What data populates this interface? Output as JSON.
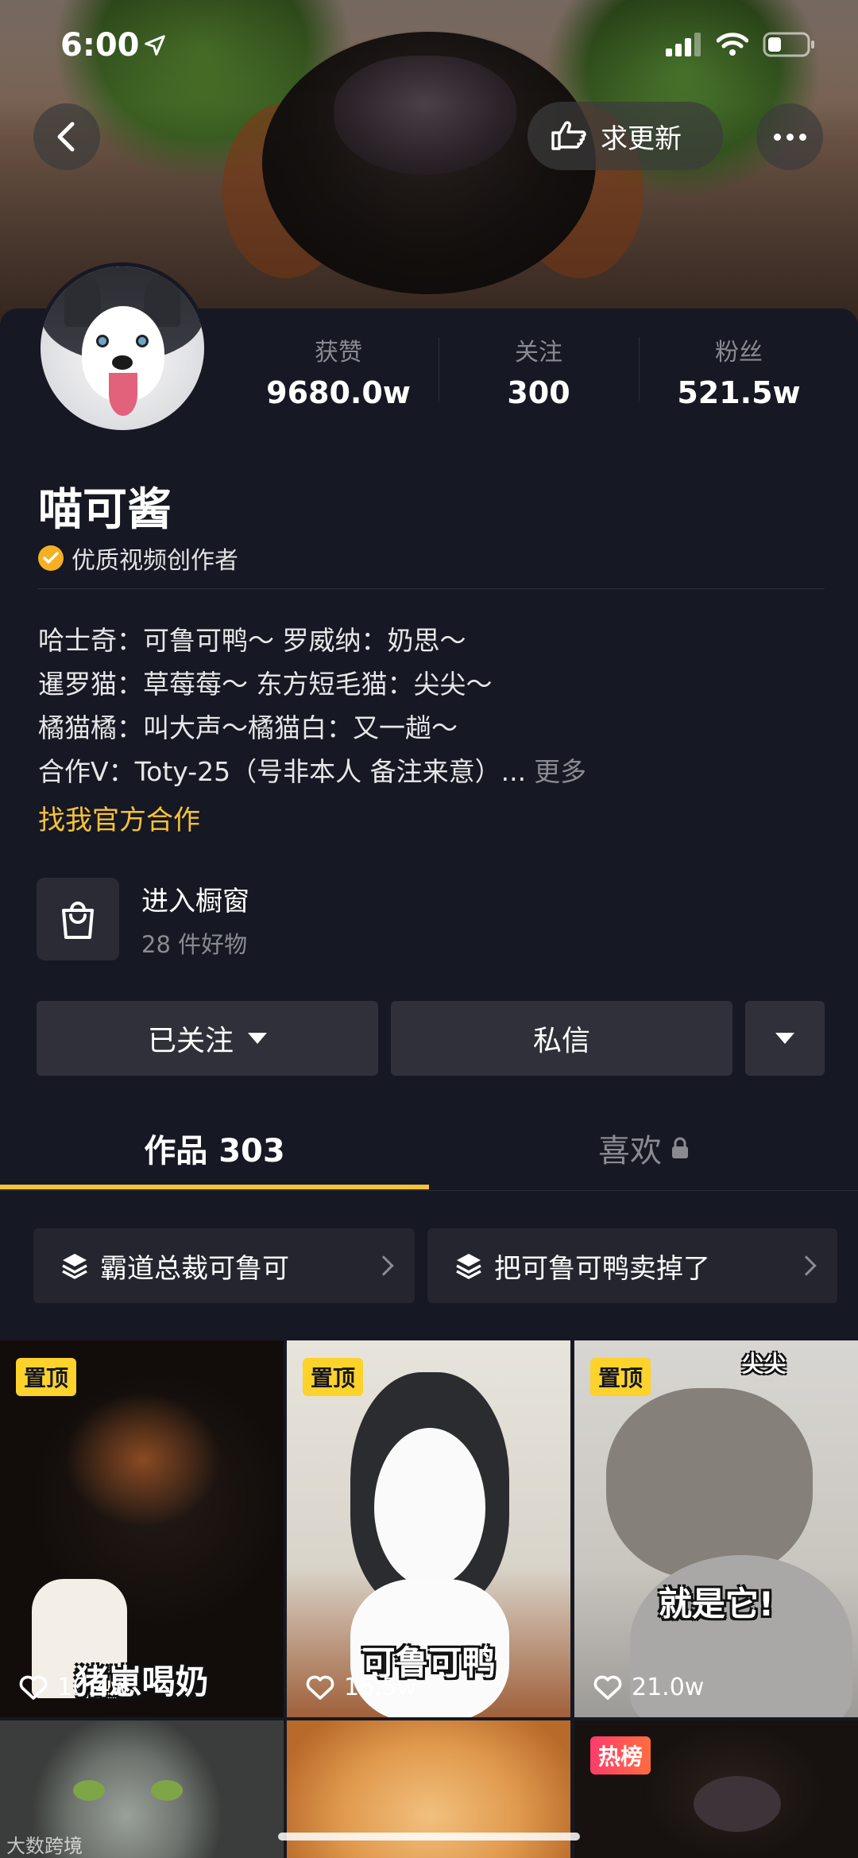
{
  "status_bar": {
    "time": "6:00"
  },
  "header": {
    "update_label": "求更新"
  },
  "profile": {
    "name": "喵可酱",
    "verified_text": "优质视频创作者",
    "stats": [
      {
        "label": "获赞",
        "value": "9680.0w"
      },
      {
        "label": "关注",
        "value": "300"
      },
      {
        "label": "粉丝",
        "value": "521.5w"
      }
    ],
    "bio_lines": [
      "哈士奇：可鲁可鸭～ 罗威纳：奶思～",
      "暹罗猫：草莓莓～ 东方短毛猫：尖尖～",
      "橘猫橘：叫大声～橘猫白：又一趟～",
      "合作V：Toty-25（号非本人 备注来意）..."
    ],
    "bio_more": "更多",
    "cooperation_link": "找我官方合作"
  },
  "shop": {
    "title": "进入橱窗",
    "subtitle": "28 件好物"
  },
  "actions": {
    "follow_label": "已关注",
    "message_label": "私信"
  },
  "tabs": {
    "works_label": "作品 303",
    "likes_label": "喜欢"
  },
  "collections": [
    {
      "label": "霸道总裁可鲁可"
    },
    {
      "label": "把可鲁可鸭卖掉了"
    }
  ],
  "videos": [
    {
      "badge": "置顶",
      "likes": "10.4w",
      "caption": "猪崽喝奶"
    },
    {
      "badge": "置顶",
      "likes": "16.5w",
      "caption": "可鲁可鸭"
    },
    {
      "badge": "置顶",
      "likes": "21.0w",
      "caption": "就是它!",
      "top_caption": "尖尖"
    },
    {
      "badge": "",
      "likes": "",
      "caption": ""
    },
    {
      "badge": "",
      "likes": "",
      "caption": ""
    },
    {
      "badge": "热榜",
      "likes": "",
      "caption": ""
    }
  ],
  "watermark": "大数跨境",
  "colors": {
    "background": "#161823",
    "accent_yellow": "#f6c237",
    "pin_badge": "#fcd22b",
    "hot_badge": "#fe3c6c"
  },
  "icons": [
    "back-arrow-icon",
    "pointing-hand-icon",
    "more-dots-icon",
    "verified-check-icon",
    "shopping-bag-icon",
    "caret-down-icon",
    "lock-icon",
    "stack-layers-icon",
    "chevron-right-icon",
    "heart-icon"
  ]
}
